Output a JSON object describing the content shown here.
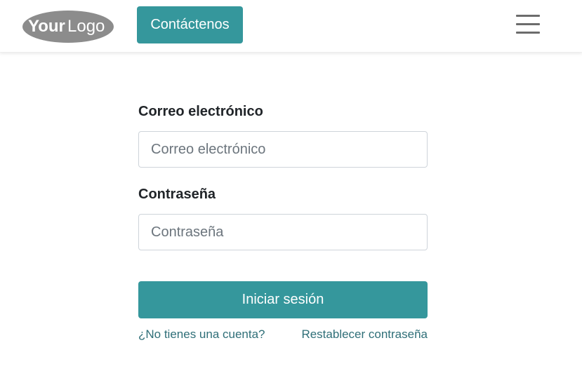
{
  "header": {
    "logo_text_bold": "Your",
    "logo_text_light": "Logo",
    "contact_label": "Contáctenos",
    "menu_icon": "hamburger-menu-icon"
  },
  "form": {
    "email_label": "Correo electrónico",
    "email_placeholder": "Correo electrónico",
    "email_value": "",
    "password_label": "Contraseña",
    "password_placeholder": "Contraseña",
    "password_value": "",
    "submit_label": "Iniciar sesión",
    "no_account_link": "¿No tienes una cuenta?",
    "reset_password_link": "Restablecer contraseña"
  },
  "colors": {
    "accent": "#35979c",
    "link": "#2f6f78",
    "logo_gray": "#8c8c8c"
  }
}
